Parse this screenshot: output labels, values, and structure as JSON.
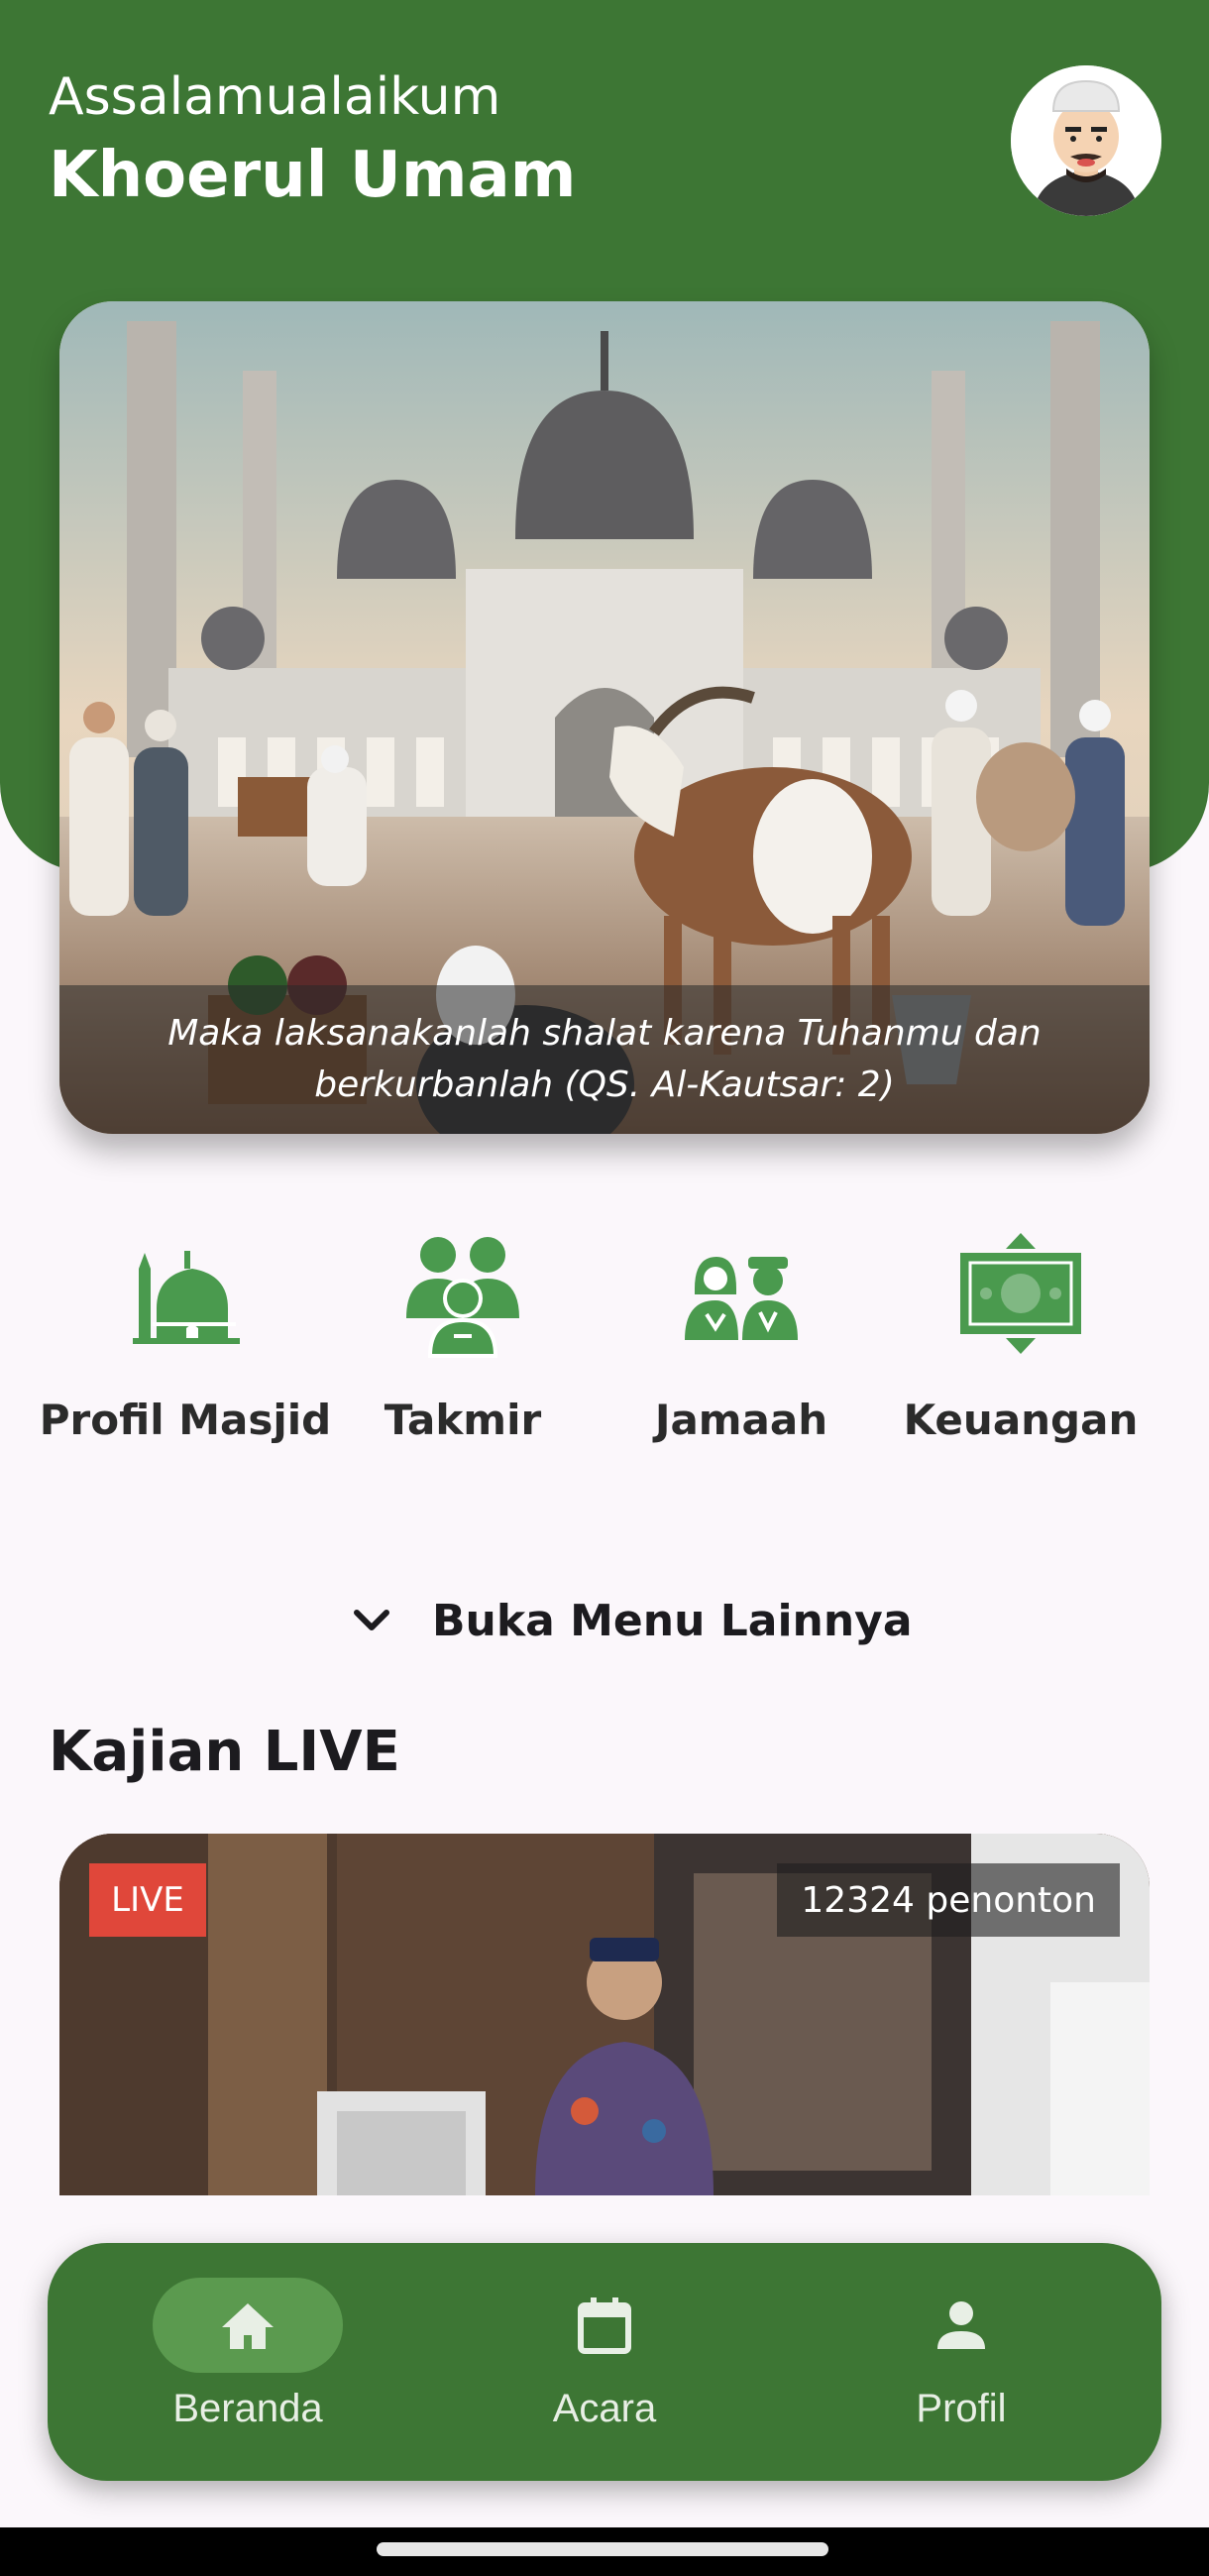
{
  "header": {
    "greeting": "Assalamualaikum",
    "user_name": "Khoerul Umam",
    "avatar_icon": "user-avatar-icon",
    "brand_color": "#3d7634"
  },
  "banner": {
    "caption": "Maka laksanakanlah shalat karena Tuhanmu dan berkurbanlah (QS. Al-Kautsar: 2)"
  },
  "menu": {
    "items": [
      {
        "label": "Profil Masjid",
        "icon": "mosque-icon"
      },
      {
        "label": "Takmir",
        "icon": "group-icon"
      },
      {
        "label": "Jamaah",
        "icon": "congregation-icon"
      },
      {
        "label": "Keuangan",
        "icon": "money-icon"
      }
    ],
    "more_label": "Buka Menu Lainnya",
    "icon_color": "#4a9a4e"
  },
  "kajian": {
    "title": "Kajian LIVE",
    "live_badge": "LIVE",
    "viewers": "12324 penonton"
  },
  "bottom_nav": {
    "items": [
      {
        "label": "Beranda",
        "icon": "home-icon",
        "active": true
      },
      {
        "label": "Acara",
        "icon": "calendar-icon",
        "active": false
      },
      {
        "label": "Profil",
        "icon": "person-icon",
        "active": false
      }
    ]
  }
}
